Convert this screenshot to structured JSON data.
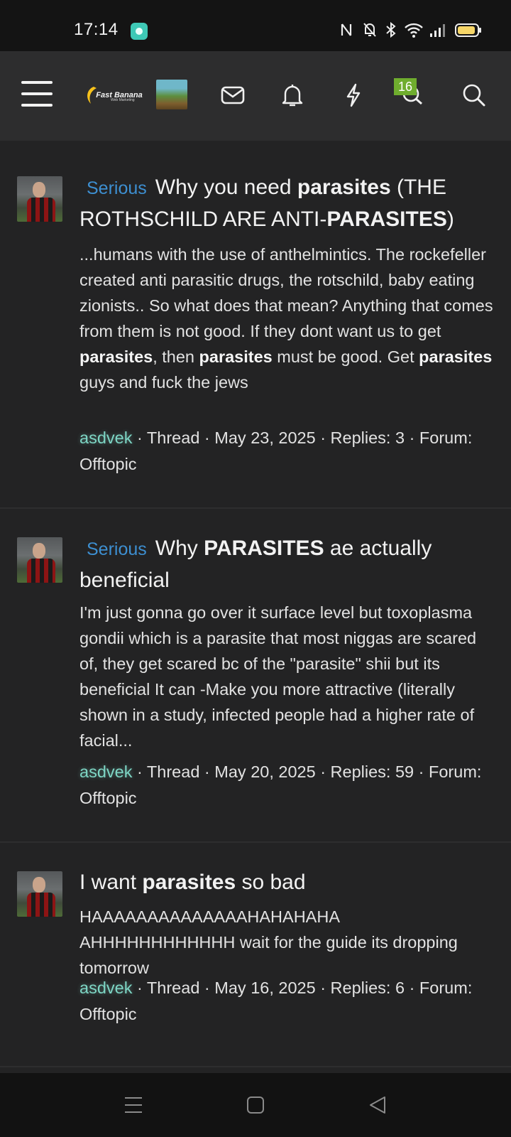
{
  "status_bar": {
    "time": "17:14",
    "icons": [
      "nfc-icon",
      "mute-icon",
      "bluetooth-icon",
      "wifi-icon",
      "signal-icon",
      "battery-icon"
    ]
  },
  "header": {
    "logo_text": "Fast Banana",
    "logo_subtext": "Web Marketing",
    "conversations_badge": "16",
    "icons": [
      "menu-icon",
      "mail-icon",
      "bell-icon",
      "lightning-icon",
      "conversations-icon",
      "search-icon"
    ]
  },
  "results": [
    {
      "prefix": "Serious",
      "title_parts": [
        {
          "text": "Why you need ",
          "bold": false
        },
        {
          "text": "parasites",
          "bold": true
        },
        {
          "text": " (THE ROTHSCHILD ARE ANTI-",
          "bold": false
        },
        {
          "text": "PARASITES",
          "bold": true
        },
        {
          "text": ")",
          "bold": false
        }
      ],
      "snippet_parts": [
        {
          "text": "...humans with the use of anthelmintics. The rockefeller created anti parasitic drugs, the rotschild, baby eating zionists.. So what does that mean? Anything that comes from them is not good. If they dont want us to get ",
          "bold": false
        },
        {
          "text": "parasites",
          "bold": true
        },
        {
          "text": ", then ",
          "bold": false
        },
        {
          "text": "parasites",
          "bold": true
        },
        {
          "text": " must be good. Get ",
          "bold": false
        },
        {
          "text": "parasites",
          "bold": true
        },
        {
          "text": " guys and fuck the jews",
          "bold": false
        }
      ],
      "author": "asdvek",
      "meta": " · Thread · May 23, 2025 · Replies: 3 · Forum: Offtopic"
    },
    {
      "prefix": "Serious",
      "title_parts": [
        {
          "text": "Why ",
          "bold": false
        },
        {
          "text": "PARASITES",
          "bold": true
        },
        {
          "text": " ae actually beneficial",
          "bold": false
        }
      ],
      "snippet_parts": [
        {
          "text": "I'm just gonna go over it surface level but toxoplasma gondii which is a parasite that most niggas are scared of, they get scared bc of the \"parasite\" shii but its beneficial It can -Make you more attractive (literally shown in a study, infected people had a higher rate of facial...",
          "bold": false
        }
      ],
      "author": "asdvek",
      "meta": " · Thread · May 20, 2025 · Replies: 59 · Forum: Offtopic"
    },
    {
      "prefix": "",
      "title_parts": [
        {
          "text": "I want ",
          "bold": false
        },
        {
          "text": "parasites",
          "bold": true
        },
        {
          "text": " so bad",
          "bold": false
        }
      ],
      "snippet_parts": [
        {
          "text": "HAAAAAAAAAAAAAAHAHAHAHA AHHHHHHHHHHHH wait for the guide its dropping tomorrow",
          "bold": false
        }
      ],
      "author": "asdvek",
      "meta": " · Thread · May 16, 2025 · Replies: 6 · Forum: Offtopic"
    }
  ],
  "colors": {
    "background": "#232324",
    "header": "#2d2d2e",
    "prefix": "#3d8fd1",
    "author": "#7ed6c5",
    "badge": "#6fad2e"
  }
}
